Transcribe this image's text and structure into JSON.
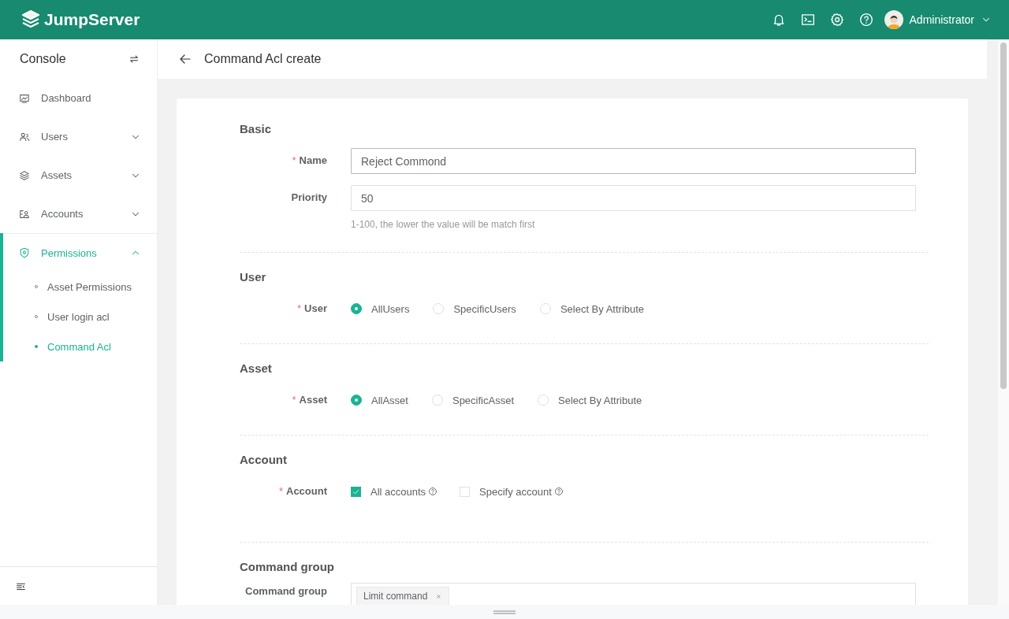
{
  "header": {
    "brand": "JumpServer",
    "user": "Administrator"
  },
  "sidebar": {
    "title": "Console",
    "items": [
      {
        "label": "Dashboard",
        "active": false
      },
      {
        "label": "Users",
        "active": false,
        "expanded": false
      },
      {
        "label": "Assets",
        "active": false,
        "expanded": false
      },
      {
        "label": "Accounts",
        "active": false,
        "expanded": false
      },
      {
        "label": "Permissions",
        "active": true,
        "expanded": true,
        "children": [
          {
            "label": "Asset Permissions",
            "selected": false
          },
          {
            "label": "User login acl",
            "selected": false
          },
          {
            "label": "Command Acl",
            "selected": true
          }
        ]
      }
    ]
  },
  "page": {
    "title": "Command Acl create"
  },
  "sections": [
    {
      "title": "Basic",
      "fields": [
        {
          "kind": "text",
          "label": "Name",
          "required_mark": "*",
          "value": "Reject Commond"
        },
        {
          "kind": "text",
          "label": "Priority",
          "value": "50",
          "help": "1-100, the lower the value will be match first"
        }
      ]
    },
    {
      "title": "User",
      "fields": [
        {
          "kind": "radio",
          "label": "User",
          "required_mark": "*",
          "options": [
            {
              "label": "AllUsers",
              "selected": true
            },
            {
              "label": "SpecificUsers",
              "selected": false
            },
            {
              "label": "Select By Attribute",
              "selected": false
            }
          ]
        }
      ]
    },
    {
      "title": "Asset",
      "fields": [
        {
          "kind": "radio",
          "label": "Asset",
          "required_mark": "*",
          "options": [
            {
              "label": "AllAsset",
              "selected": true
            },
            {
              "label": "SpecificAsset",
              "selected": false
            },
            {
              "label": "Select By Attribute",
              "selected": false
            }
          ]
        }
      ]
    },
    {
      "title": "Account",
      "fields": [
        {
          "kind": "checkbox",
          "label": "Account",
          "required_mark": "*",
          "options": [
            {
              "label": "All accounts",
              "checked": true,
              "info": true
            },
            {
              "label": "Specify account",
              "checked": false,
              "info": true
            }
          ]
        }
      ]
    },
    {
      "title": "Command group",
      "fields": [
        {
          "kind": "tags",
          "label": "Command group",
          "tags": [
            "Limit command"
          ]
        }
      ]
    }
  ]
}
